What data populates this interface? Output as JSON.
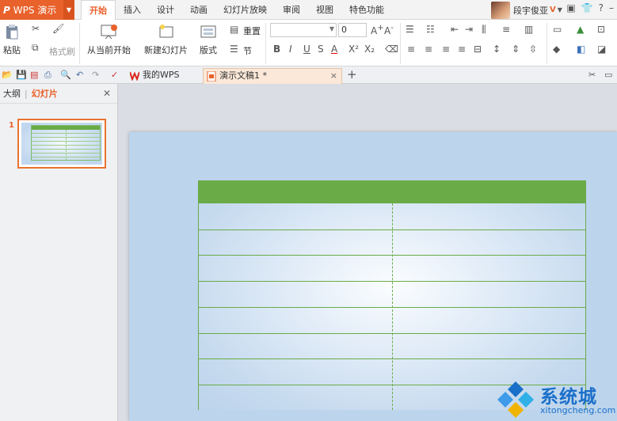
{
  "app": {
    "name": "WPS 演示",
    "logo": "P"
  },
  "tabs": [
    "开始",
    "插入",
    "设计",
    "动画",
    "幻灯片放映",
    "审阅",
    "视图",
    "特色功能"
  ],
  "active_tab": "开始",
  "user": {
    "name": "段宇俊亚",
    "badge": "V"
  },
  "ribbon": {
    "paste": "粘贴",
    "format_painter": "格式刷",
    "from_current": "从当前开始",
    "new_slide": "新建幻灯片",
    "layout": "版式",
    "reset": "重置",
    "section": "节",
    "font_size": "0"
  },
  "doc_tabs": [
    {
      "label": "我的WPS"
    },
    {
      "label": "演示文稿1 *"
    }
  ],
  "left_pane": {
    "outline": "大纲",
    "slides": "幻灯片",
    "slide_number": "1"
  },
  "table": {
    "rows": 8,
    "cols": 2,
    "header_color": "#6aab47",
    "border_color": "#6aab47"
  },
  "watermark": {
    "text": "系统城",
    "url": "xitongcheng.com"
  },
  "colors": {
    "accent": "#e9612b",
    "slide_bg": "#bcd4ec"
  }
}
